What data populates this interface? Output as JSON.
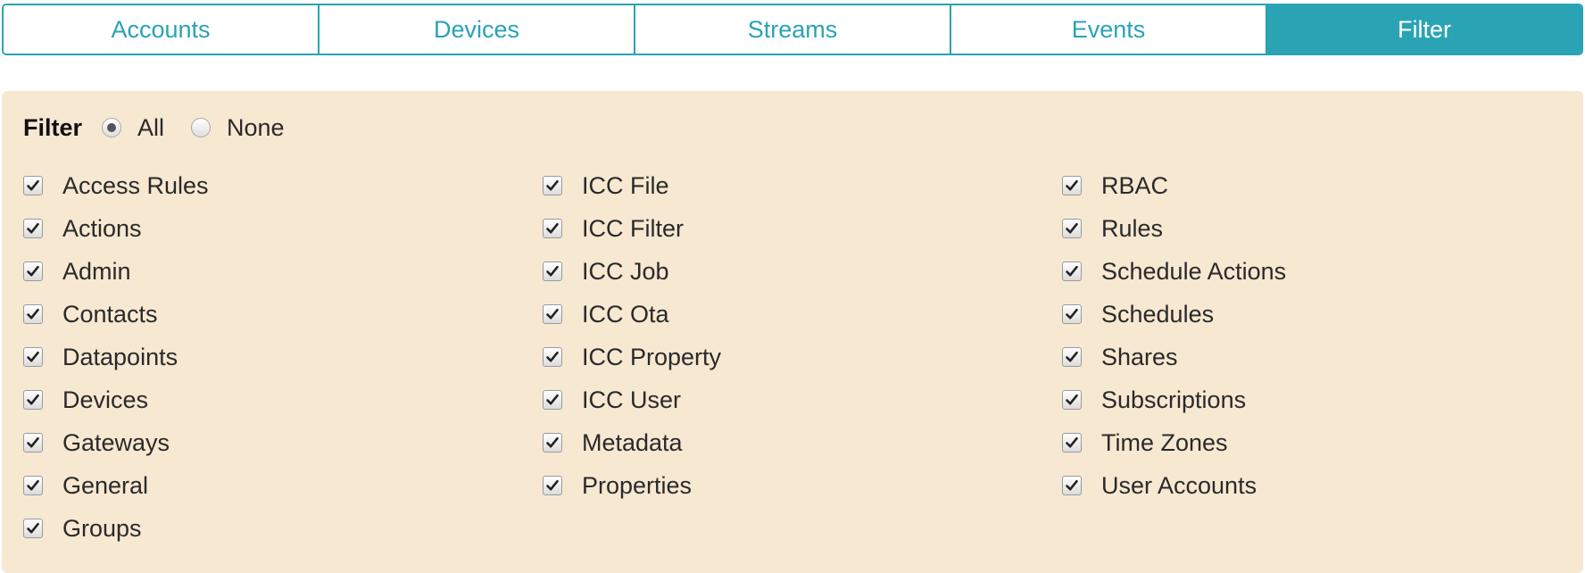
{
  "tabs": [
    {
      "label": "Accounts",
      "active": false
    },
    {
      "label": "Devices",
      "active": false
    },
    {
      "label": "Streams",
      "active": false
    },
    {
      "label": "Events",
      "active": false
    },
    {
      "label": "Filter",
      "active": true
    }
  ],
  "filter": {
    "title": "Filter",
    "options": [
      {
        "label": "All",
        "selected": true
      },
      {
        "label": "None",
        "selected": false
      }
    ]
  },
  "columns": [
    [
      {
        "label": "Access Rules",
        "checked": true
      },
      {
        "label": "Actions",
        "checked": true
      },
      {
        "label": "Admin",
        "checked": true
      },
      {
        "label": "Contacts",
        "checked": true
      },
      {
        "label": "Datapoints",
        "checked": true
      },
      {
        "label": "Devices",
        "checked": true
      },
      {
        "label": "Gateways",
        "checked": true
      },
      {
        "label": "General",
        "checked": true
      },
      {
        "label": "Groups",
        "checked": true
      }
    ],
    [
      {
        "label": "ICC File",
        "checked": true
      },
      {
        "label": "ICC Filter",
        "checked": true
      },
      {
        "label": "ICC Job",
        "checked": true
      },
      {
        "label": "ICC Ota",
        "checked": true
      },
      {
        "label": "ICC Property",
        "checked": true
      },
      {
        "label": "ICC User",
        "checked": true
      },
      {
        "label": "Metadata",
        "checked": true
      },
      {
        "label": "Properties",
        "checked": true
      }
    ],
    [
      {
        "label": "RBAC",
        "checked": true
      },
      {
        "label": "Rules",
        "checked": true
      },
      {
        "label": "Schedule Actions",
        "checked": true
      },
      {
        "label": "Schedules",
        "checked": true
      },
      {
        "label": "Shares",
        "checked": true
      },
      {
        "label": "Subscriptions",
        "checked": true
      },
      {
        "label": "Time Zones",
        "checked": true
      },
      {
        "label": "User Accounts",
        "checked": true
      }
    ]
  ],
  "colors": {
    "accent": "#2aa3b5",
    "panel_bg": "#f7e8d2"
  },
  "icons": {
    "checkbox": "checkmark-icon",
    "radio": "radio-dot-icon"
  }
}
